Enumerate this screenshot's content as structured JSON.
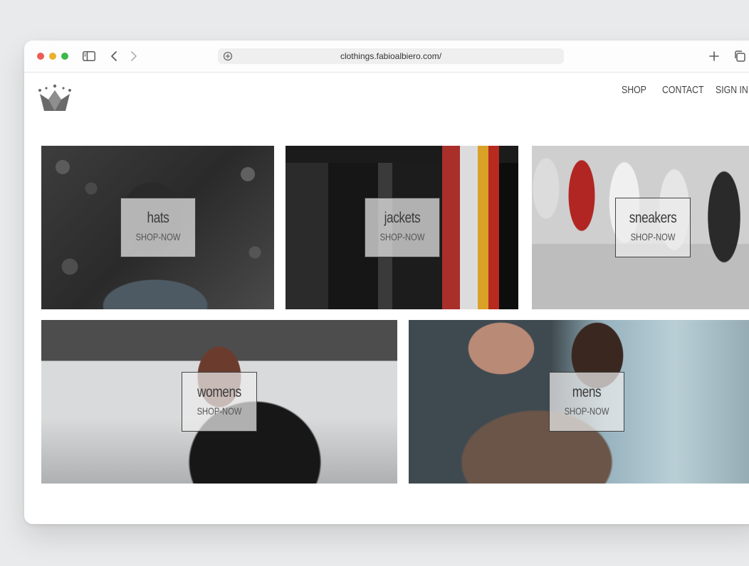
{
  "browser": {
    "url": "clothings.fabioalbiero.com/"
  },
  "nav": {
    "shop": "SHOP",
    "contact": "CONTACT",
    "signin": "SIGN IN"
  },
  "categories": [
    {
      "title": "hats",
      "cta": "SHOP-NOW"
    },
    {
      "title": "jackets",
      "cta": "SHOP-NOW"
    },
    {
      "title": "sneakers",
      "cta": "SHOP-NOW"
    },
    {
      "title": "womens",
      "cta": "SHOP-NOW"
    },
    {
      "title": "mens",
      "cta": "SHOP-NOW"
    }
  ],
  "colors": {
    "close": "#ee5d55",
    "minimize": "#eab12b",
    "maximize": "#3cb84a",
    "logo": "#6a6a6a"
  },
  "icons": {
    "sidebar": "sidebar-icon",
    "back": "chevron-left-icon",
    "forward": "chevron-right-icon",
    "site_settings": "site-settings-icon",
    "new_tab": "plus-icon",
    "tabs": "tab-overview-icon",
    "logo": "crown-icon"
  }
}
